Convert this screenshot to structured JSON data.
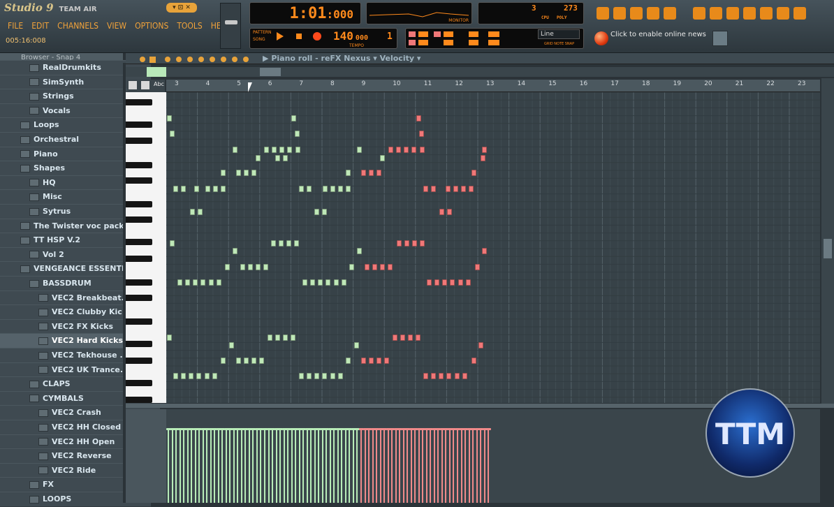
{
  "app": {
    "logo": "Studio 9",
    "logo_sub": "TEAM AIR",
    "window_buttons": "▾ ⊡ ✕"
  },
  "menu": [
    "FILE",
    "EDIT",
    "CHANNELS",
    "VIEW",
    "OPTIONS",
    "TOOLS",
    "HELP"
  ],
  "hint_time": "005:16:008",
  "time_display": {
    "main": "1:01",
    "sub": ":000"
  },
  "cpu_display": {
    "value1": "3",
    "value2": "273",
    "cpu_label": "CPU",
    "poly_label": "POLY"
  },
  "tempo": {
    "value": "140",
    "decimals": "000",
    "label": "TEMPO"
  },
  "pattern_label": "PATTERN",
  "song_label": "SONG",
  "pattern_number": "1",
  "snap": {
    "selected": "Line",
    "label": "GRID NOTE SNAP"
  },
  "news": {
    "text": "Click to enable online news"
  },
  "monitor_label": "MONITOR",
  "browser": {
    "title": "Browser - Snap 4",
    "items": [
      {
        "label": "RealDrumkits",
        "level": 2
      },
      {
        "label": "SimSynth",
        "level": 2
      },
      {
        "label": "Strings",
        "level": 2
      },
      {
        "label": "Vocals",
        "level": 2
      },
      {
        "label": "Loops",
        "level": 1
      },
      {
        "label": "Orchestral",
        "level": 1
      },
      {
        "label": "Piano",
        "level": 1
      },
      {
        "label": "Shapes",
        "level": 1
      },
      {
        "label": "HQ",
        "level": 2
      },
      {
        "label": "Misc",
        "level": 2
      },
      {
        "label": "Sytrus",
        "level": 2
      },
      {
        "label": "The Twister voc pack",
        "level": 1
      },
      {
        "label": "TT HSP V.2",
        "level": 1
      },
      {
        "label": "Vol 2",
        "level": 2
      },
      {
        "label": "VENGEANCE ESSENTI...",
        "level": 1
      },
      {
        "label": "BASSDRUM",
        "level": 2
      },
      {
        "label": "VEC2 Breakbeat...",
        "level": 3
      },
      {
        "label": "VEC2 Clubby Kic...",
        "level": 3
      },
      {
        "label": "VEC2 FX Kicks",
        "level": 3
      },
      {
        "label": "VEC2 Hard Kicks",
        "level": 3,
        "selected": true
      },
      {
        "label": "VEC2 Tekhouse ...",
        "level": 3
      },
      {
        "label": "VEC2 UK Trance...",
        "level": 3
      },
      {
        "label": "CLAPS",
        "level": 2
      },
      {
        "label": "CYMBALS",
        "level": 2
      },
      {
        "label": "VEC2 Crash",
        "level": 3
      },
      {
        "label": "VEC2 HH Closed",
        "level": 3
      },
      {
        "label": "VEC2 HH Open",
        "level": 3
      },
      {
        "label": "VEC2 Reverse",
        "level": 3
      },
      {
        "label": "VEC2 Ride",
        "level": 3
      },
      {
        "label": "FX",
        "level": 2
      },
      {
        "label": "LOOPS",
        "level": 2
      }
    ]
  },
  "piano_roll": {
    "title_arrow": "▶",
    "title": "Piano roll - reFX Nexus",
    "separator": "▾",
    "target": "Velocity",
    "target_arrow": "▾",
    "ruler": [
      "3",
      "4",
      "5",
      "6",
      "7",
      "8",
      "9",
      "10",
      "11",
      "12",
      "13",
      "14",
      "15",
      "16",
      "17",
      "18",
      "19",
      "20",
      "21",
      "22",
      "23"
    ],
    "snap_btn_label": "Abc",
    "note_colors": {
      "green": "#bfe8b8",
      "red": "#f07878"
    }
  },
  "velocity_colors": {
    "green": "#b8ecb8",
    "red": "#f08a8a"
  },
  "watermark": "TTM"
}
